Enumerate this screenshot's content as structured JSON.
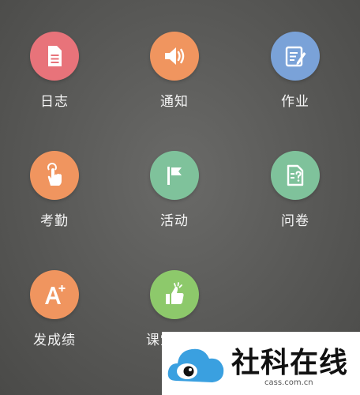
{
  "colors": {
    "red": "#e8737a",
    "orange": "#f0955f",
    "blue": "#7aa2d8",
    "green": "#7fc29b",
    "lime": "#8dc96b"
  },
  "menu": {
    "items": [
      {
        "label": "日志",
        "icon": "document-icon",
        "color": "#e8737a"
      },
      {
        "label": "通知",
        "icon": "speaker-icon",
        "color": "#f0955f"
      },
      {
        "label": "作业",
        "icon": "edit-note-icon",
        "color": "#7aa2d8"
      },
      {
        "label": "考勤",
        "icon": "hand-tap-icon",
        "color": "#f0955f"
      },
      {
        "label": "活动",
        "icon": "flag-icon",
        "color": "#7fc29b"
      },
      {
        "label": "问卷",
        "icon": "questionnaire-icon",
        "color": "#7fc29b"
      },
      {
        "label": "发成绩",
        "icon": "grade-plus-icon",
        "color": "#f0955f"
      },
      {
        "label": "课堂表现",
        "icon": "thumbs-up-icon",
        "color": "#8dc96b"
      }
    ]
  },
  "watermark": {
    "title": "社科在线",
    "subtitle": "cass.com.cn"
  }
}
